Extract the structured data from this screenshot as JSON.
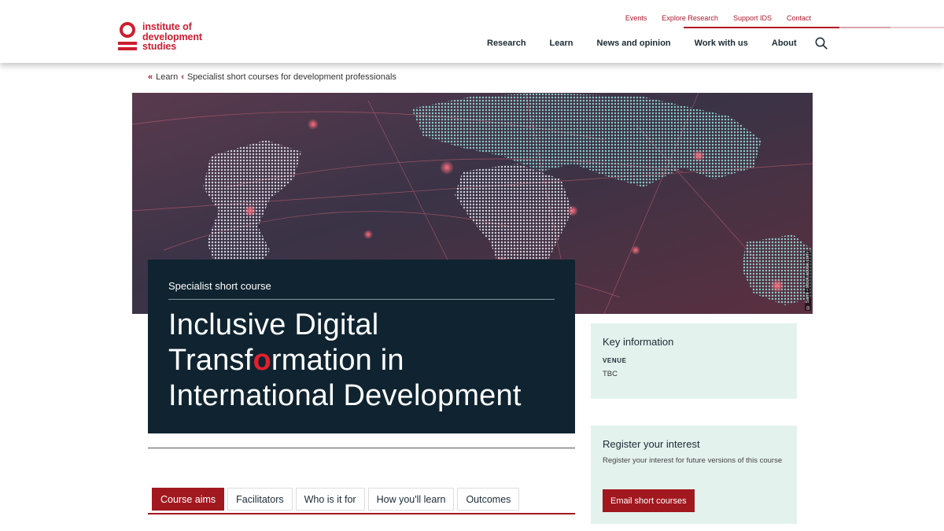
{
  "logo": {
    "lines": [
      "institute of",
      "development",
      "studies"
    ]
  },
  "utility_nav": [
    "Events",
    "Explore Research",
    "Support IDS",
    "Contact"
  ],
  "main_nav": [
    "Research",
    "Learn",
    "News and opinion",
    "Work with us",
    "About"
  ],
  "search": {
    "icon": "search-icon"
  },
  "breadcrumb": {
    "items": [
      "Learn",
      "Specialist short courses for development professionals"
    ]
  },
  "hero": {
    "credit": "© Sami - stock.adobe.com"
  },
  "course": {
    "kicker": "Specialist short course",
    "title_line1": "Inclusive Digital",
    "title_line2_a": "Transf",
    "title_line2_o": "o",
    "title_line2_b": "rmation in",
    "title_line3": "International Development"
  },
  "tabs": [
    "Course aims",
    "Facilitators",
    "Who is it for",
    "How you'll learn",
    "Outcomes"
  ],
  "key_info": {
    "heading": "Key information",
    "venue_label": "VENUE",
    "venue_value": "TBC"
  },
  "register": {
    "heading": "Register your interest",
    "text": "Register your interest for future versions of this course",
    "button": "Email short courses"
  },
  "colors": {
    "brand_red": "#cc1f2f",
    "button_red": "#a1181f",
    "title_bg": "#0f2430",
    "panel_bg": "#e4f2ee"
  }
}
